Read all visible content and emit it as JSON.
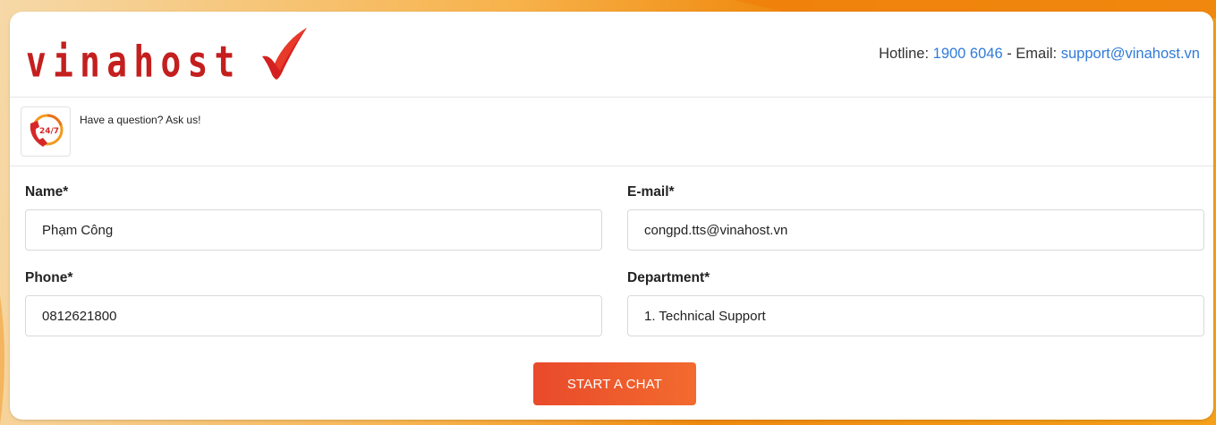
{
  "header": {
    "logo_text": "vinahost",
    "hotline_label": "Hotline: ",
    "hotline_number": "1900 6046",
    "separator": " - Email: ",
    "email": "support@vinahost.vn"
  },
  "question": {
    "badge_text": "24/7",
    "text": "Have a question? Ask us!"
  },
  "form": {
    "name": {
      "label": "Name*",
      "value": "Phạm Công"
    },
    "email": {
      "label": "E-mail*",
      "value": "congpd.tts@vinahost.vn"
    },
    "phone": {
      "label": "Phone*",
      "value": "0812621800"
    },
    "department": {
      "label": "Department*",
      "value": "1. Technical Support"
    },
    "submit_label": "START A CHAT"
  },
  "colors": {
    "brand_red": "#c41f1f",
    "link_blue": "#2f7bd9",
    "button_start": "#e94a2b",
    "button_end": "#f26b2e"
  }
}
